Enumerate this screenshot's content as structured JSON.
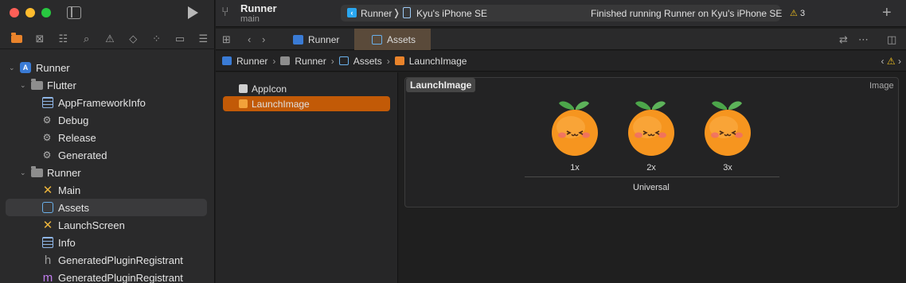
{
  "toolbar": {
    "project_name": "Runner",
    "branch": "main",
    "scheme": "Runner",
    "scheme_separator": "❭",
    "device": "Kyu's iPhone SE",
    "status": "Finished running Runner on Kyu's iPhone SE",
    "warning_count": "3"
  },
  "navigator": {
    "tree": [
      {
        "label": "Runner",
        "kind": "project"
      },
      {
        "label": "Flutter",
        "kind": "folder"
      },
      {
        "label": "AppFrameworkInfo",
        "kind": "plist"
      },
      {
        "label": "Debug",
        "kind": "xcconfig"
      },
      {
        "label": "Release",
        "kind": "xcconfig"
      },
      {
        "label": "Generated",
        "kind": "xcconfig"
      },
      {
        "label": "Runner",
        "kind": "folder"
      },
      {
        "label": "Main",
        "kind": "storyboard"
      },
      {
        "label": "Assets",
        "kind": "assets",
        "selected": true
      },
      {
        "label": "LaunchScreen",
        "kind": "storyboard"
      },
      {
        "label": "Info",
        "kind": "plist"
      },
      {
        "label": "GeneratedPluginRegistrant",
        "kind": "header"
      },
      {
        "label": "GeneratedPluginRegistrant",
        "kind": "implementation"
      }
    ]
  },
  "tabs": [
    {
      "label": "Runner",
      "active": false
    },
    {
      "label": "Assets",
      "active": true
    }
  ],
  "breadcrumb": [
    "Runner",
    "Runner",
    "Assets",
    "LaunchImage"
  ],
  "asset_catalog": {
    "items": [
      {
        "label": "AppIcon",
        "selected": false
      },
      {
        "label": "LaunchImage",
        "selected": true
      }
    ],
    "set_name": "LaunchImage",
    "set_type": "Image",
    "slots": [
      "1x",
      "2x",
      "3x"
    ],
    "idiom": "Universal"
  },
  "colors": {
    "accent": "#e9832b",
    "selection": "#c25a07",
    "warning": "#f2c01e"
  }
}
